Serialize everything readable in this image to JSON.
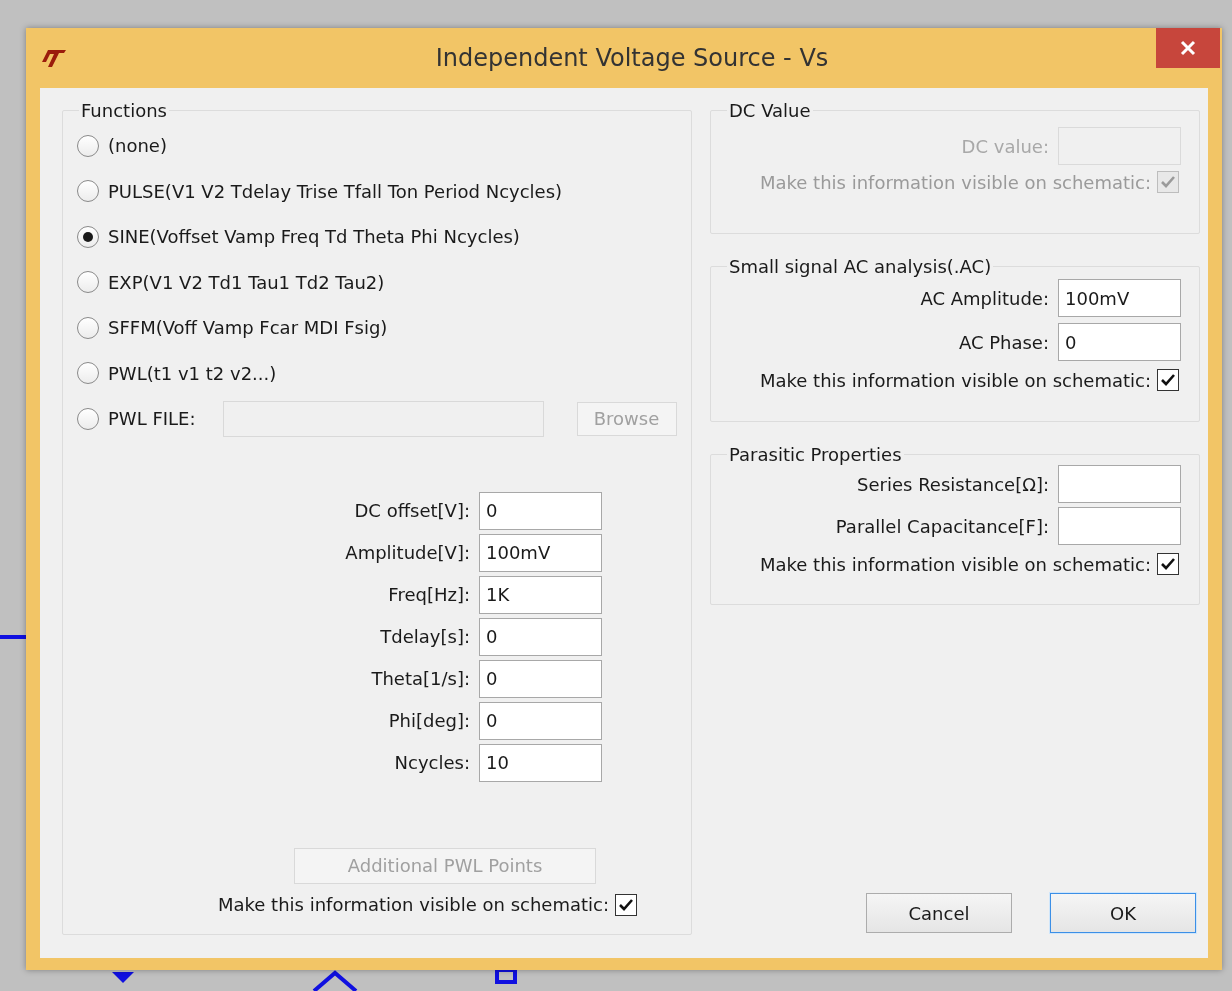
{
  "window": {
    "title": "Independent Voltage Source - Vs"
  },
  "functions": {
    "title": "Functions",
    "options": [
      {
        "kind": "radio",
        "label": "(none)",
        "selected": false
      },
      {
        "kind": "radio",
        "label": "PULSE(V1 V2 Tdelay Trise Tfall Ton Period Ncycles)",
        "selected": false
      },
      {
        "kind": "radio",
        "label": "SINE(Voffset Vamp Freq Td Theta Phi Ncycles)",
        "selected": true
      },
      {
        "kind": "radio",
        "label": "EXP(V1 V2 Td1 Tau1 Td2 Tau2)",
        "selected": false
      },
      {
        "kind": "radio",
        "label": "SFFM(Voff Vamp Fcar MDI Fsig)",
        "selected": false
      },
      {
        "kind": "radio",
        "label": "PWL(t1 v1 t2 v2...)",
        "selected": false
      },
      {
        "kind": "file",
        "label": "PWL FILE:",
        "selected": false,
        "button": "Browse",
        "disabled": true
      }
    ],
    "parameters": [
      {
        "label": "DC offset[V]:",
        "value": "0"
      },
      {
        "label": "Amplitude[V]:",
        "value": "100mV"
      },
      {
        "label": "Freq[Hz]:",
        "value": "1K"
      },
      {
        "label": "Tdelay[s]:",
        "value": "0"
      },
      {
        "label": "Theta[1/s]:",
        "value": "0"
      },
      {
        "label": "Phi[deg]:",
        "value": "0"
      },
      {
        "label": "Ncycles:",
        "value": "10"
      }
    ],
    "pwl_button": {
      "label": "Additional PWL Points",
      "disabled": true
    },
    "visible": {
      "label": "Make this information visible on schematic:",
      "checked": true,
      "disabled": false
    }
  },
  "dc_value": {
    "title": "DC Value",
    "fields": [
      {
        "label": "DC value:",
        "disabled": true
      }
    ],
    "visible": {
      "label": "Make this information visible on schematic:",
      "checked": true,
      "disabled": true
    }
  },
  "ac_analysis": {
    "title": "Small signal AC analysis(.AC)",
    "fields": [
      {
        "label": "AC Amplitude:",
        "value": "100mV",
        "disabled": false
      },
      {
        "label": "AC Phase:",
        "value": "0",
        "disabled": false
      }
    ],
    "visible": {
      "label": "Make this information visible on schematic:",
      "checked": true,
      "disabled": false
    }
  },
  "parasitic": {
    "title": "Parasitic Properties",
    "fields": [
      {
        "label": "Series Resistance[Ω]:",
        "disabled": false
      },
      {
        "label": "Parallel Capacitance[F]:",
        "disabled": false
      }
    ],
    "visible": {
      "label": "Make this information visible on schematic:",
      "checked": true,
      "disabled": false
    }
  },
  "buttons": [
    {
      "label": "Cancel",
      "default": false
    },
    {
      "label": "OK",
      "default": true
    }
  ]
}
